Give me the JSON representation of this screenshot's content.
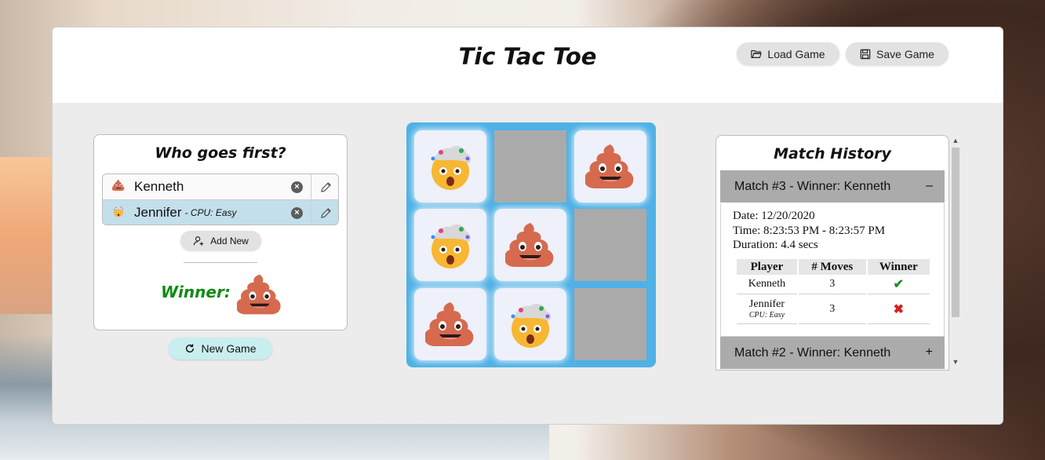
{
  "header": {
    "title": "Tic Tac Toe",
    "load_label": "Load Game",
    "save_label": "Save Game"
  },
  "who_first": {
    "title": "Who goes first?",
    "players": [
      {
        "name": "Kenneth",
        "subtitle": "",
        "emoji": "pile-of-poo",
        "selected": false
      },
      {
        "name": "Jennifer",
        "subtitle": "- CPU: Easy",
        "emoji": "exploding-head",
        "selected": true
      }
    ],
    "add_new_label": "Add New",
    "winner_label": "Winner:",
    "winner_emoji": "pile-of-poo"
  },
  "new_game_label": "New Game",
  "board": {
    "cells": [
      "exploding-head",
      "",
      "pile-of-poo",
      "exploding-head",
      "pile-of-poo",
      "",
      "pile-of-poo",
      "exploding-head",
      ""
    ]
  },
  "history": {
    "title": "Match History",
    "matches": [
      {
        "header": "Match #3 - Winner: Kenneth",
        "toggle": "–",
        "expanded": true,
        "date": "Date: 12/20/2020",
        "time": "Time: 8:23:53 PM - 8:23:57 PM",
        "duration": "Duration: 4.4 secs",
        "columns": [
          "Player",
          "# Moves",
          "Winner"
        ],
        "rows": [
          {
            "player": "Kenneth",
            "sub": "",
            "moves": "3",
            "winner": true
          },
          {
            "player": "Jennifer",
            "sub": "CPU: Easy",
            "moves": "3",
            "winner": false
          }
        ]
      },
      {
        "header": "Match #2 - Winner: Kenneth",
        "toggle": "+",
        "expanded": false
      }
    ]
  },
  "colors": {
    "board": "#4fb1e6",
    "empty_cell": "#aaaaaa",
    "winner_text": "#0f8a14",
    "selected_row": "#c3dfec",
    "new_game_button": "#c9eef0"
  }
}
